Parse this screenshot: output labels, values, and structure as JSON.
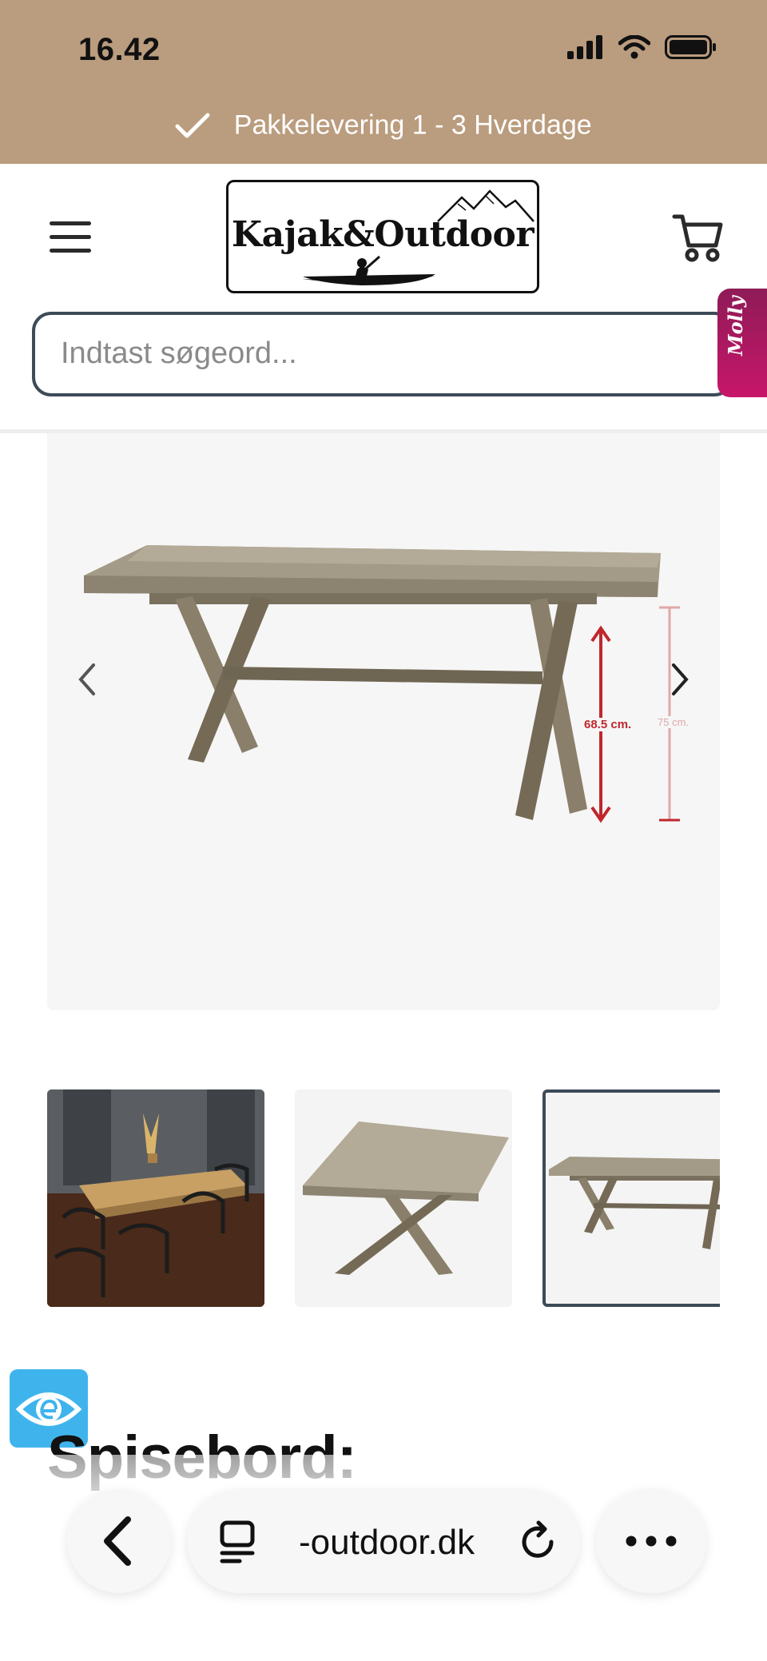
{
  "status_bar": {
    "time": "16.42"
  },
  "announcement": {
    "text": "Pakkelevering 1 - 3 Hverdage"
  },
  "header": {
    "logo_text": "Kajak&Outdoor",
    "search_placeholder": "Indtast søgeord..."
  },
  "molly_widget": {
    "label": "Molly"
  },
  "product": {
    "image_labels": {
      "dimension_1": "68.5 cm.",
      "dimension_2": "75 cm."
    },
    "title_partial": "Spisebord:"
  },
  "browser": {
    "url": "-outdoor.dk"
  },
  "colors": {
    "topbar": "#ba9c7e",
    "search_border": "#3d4b57",
    "molly": "#c8166a",
    "eye_widget": "#3fb4ec",
    "dimension_red": "#c0272d"
  },
  "icons": [
    "check-icon",
    "menu-icon",
    "cart-icon",
    "chevron-left-icon",
    "chevron-right-icon",
    "eye-icon",
    "back-icon",
    "tabs-icon",
    "reload-icon",
    "more-icon",
    "signal-icon",
    "wifi-icon",
    "battery-icon"
  ]
}
